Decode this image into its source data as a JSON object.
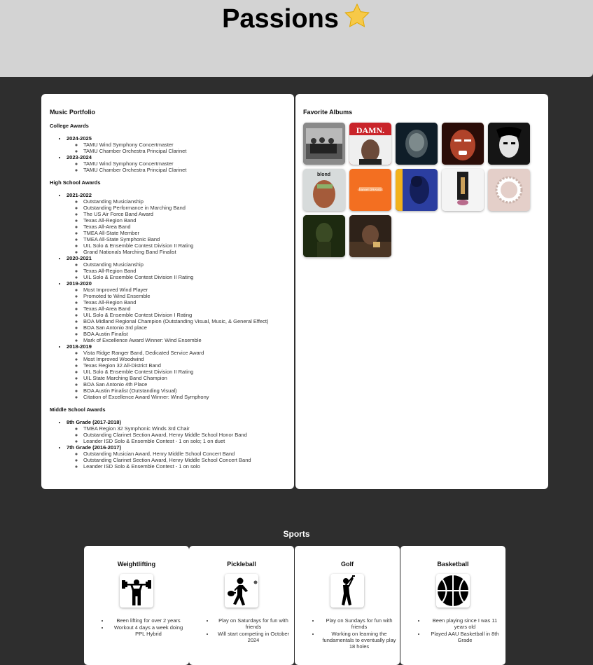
{
  "header": {
    "title": "Passions"
  },
  "music": {
    "title": "Music Portfolio",
    "sections": [
      {
        "heading": "College Awards",
        "years": [
          {
            "label": "2024-2025",
            "awards": [
              "TAMU Wind Symphony Concertmaster",
              "TAMU Chamber Orchestra Principal Clarinet"
            ]
          },
          {
            "label": "2023-2024",
            "awards": [
              "TAMU Wind Symphony Concertmaster",
              "TAMU Chamber Orchestra Principal Clarinet"
            ]
          }
        ]
      },
      {
        "heading": "High School Awards",
        "years": [
          {
            "label": "2021-2022",
            "awards": [
              "Outstanding Musicianship",
              "Outstanding Performance in Marching Band",
              "The US Air Force Band Award",
              "Texas All-Region Band",
              "Texas All-Area Band",
              "TMEA All-State Member",
              "TMEA All-State Symphonic Band",
              "UIL Solo & Ensemble Contest Division II Rating",
              "Grand Nationals Marching Band Finalist"
            ]
          },
          {
            "label": "2020-2021",
            "awards": [
              "Outstanding Musicianship",
              "Texas All-Region Band",
              "UIL Solo & Ensemble Contest Division II Rating"
            ]
          },
          {
            "label": "2019-2020",
            "awards": [
              "Most Improved Wind Player",
              "Promoted to Wind Ensemble",
              "Texas All-Region Band",
              "Texas All-Area Band",
              "UIL Solo & Ensemble Contest Division I Rating",
              "BOA Midland Regional Champion (Outstanding Visual, Music, & General Effect)",
              "BOA San Antonio 3rd place",
              "BOA Austin Finalist",
              "Mark of Excellence Award Winner: Wind Ensemble"
            ]
          },
          {
            "label": "2018-2019",
            "awards": [
              "Vista Ridge Ranger Band, Dedicated Service Award",
              "Most Improved Woodwind",
              "Texas Region 32 All-District Band",
              "UIL Solo & Ensemble Contest Division II Rating",
              "UIL State Marching Band Champion",
              "BOA San Antonio 4th Place",
              "BOA Austin Finalist (Outstanding Visual)",
              "Citation of Excellence Award Winner: Wind Symphony"
            ]
          }
        ]
      },
      {
        "heading": "Middle School Awards",
        "years": [
          {
            "label": "8th Grade (2017-2018)",
            "awards": [
              "TMEA Region 32 Symphonic Winds 3rd Chair",
              "Outstanding Clarinet Section Award, Henry Middle School Honor Band",
              "Leander ISD Solo & Ensemble Contest - 1 on solo; 1 on duet"
            ]
          },
          {
            "label": "7th Grade (2016-2017)",
            "awards": [
              "Outstanding Musician Award, Henry Middle School Concert Band",
              "Outstanding Clarinet Section Award, Henry Middle School Concert Band",
              "Leander ISD Solo & Ensemble Contest - 1 on solo"
            ]
          }
        ]
      }
    ]
  },
  "albums": {
    "title": "Favorite Albums",
    "items": [
      {
        "art": "kendrick-tpab",
        "bg": "#7d7d7d"
      },
      {
        "art": "damn",
        "bg": "#c9242a"
      },
      {
        "art": "dawn-fm",
        "bg": "#0f1d28"
      },
      {
        "art": "after-hours",
        "bg": "#a23a1f"
      },
      {
        "art": "trilogy",
        "bg": "#1c1c1c"
      },
      {
        "art": "blond",
        "bg": "#cfd5d6"
      },
      {
        "art": "channel-orange",
        "bg": "#f36f21"
      },
      {
        "art": "face-of-god",
        "bg": "#2b3ea0"
      },
      {
        "art": "mr-morale",
        "bg": "#f4f4f4"
      },
      {
        "art": "divine-feminine",
        "bg": "#e4cfc9"
      },
      {
        "art": "dark-green",
        "bg": "#1d2a10"
      },
      {
        "art": "take-care",
        "bg": "#3a2a1e"
      }
    ]
  },
  "sports": {
    "title": "Sports",
    "items": [
      {
        "name": "Weightlifting",
        "icon": "weightlifting-icon",
        "notes": [
          "Been lifting for over 2 years",
          "Workout 4 days a week doing PPL Hybrid"
        ]
      },
      {
        "name": "Pickleball",
        "icon": "pickleball-icon",
        "notes": [
          "Play on Saturdays for fun with friends",
          "Will start competing in October 2024"
        ]
      },
      {
        "name": "Golf",
        "icon": "golf-icon",
        "notes": [
          "Play on Sundays for fun with friends",
          "Working on learning the fundamentals to eventually play 18 holes"
        ]
      },
      {
        "name": "Basketball",
        "icon": "basketball-icon",
        "notes": [
          "Been playing since I was 11 years old",
          "Played AAU Basketball in 8th Grade"
        ]
      }
    ]
  }
}
